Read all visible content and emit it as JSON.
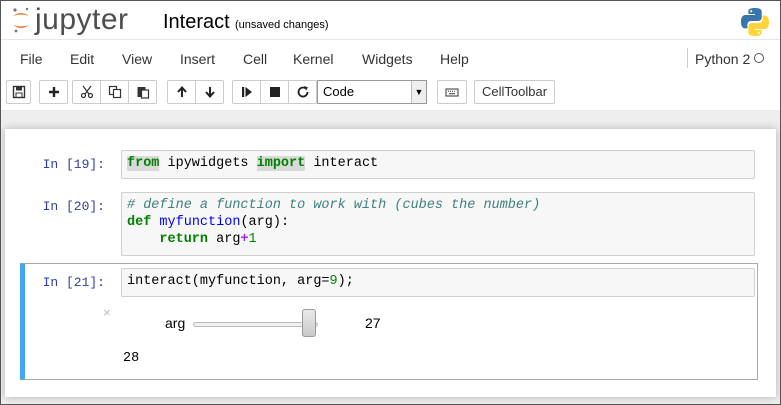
{
  "header": {
    "logo_text": "jupyter",
    "notebook_title": "Interact",
    "save_status": "(unsaved changes)"
  },
  "menubar": {
    "items": [
      "File",
      "Edit",
      "View",
      "Insert",
      "Cell",
      "Kernel",
      "Widgets",
      "Help"
    ],
    "kernel_name": "Python 2"
  },
  "toolbar": {
    "buttons": [
      "save-icon",
      "plus-icon",
      "scissors-icon",
      "copy-icon",
      "paste-icon",
      "arrow-up-icon",
      "arrow-down-icon",
      "step-forward-icon",
      "stop-icon",
      "refresh-icon",
      "keyboard-icon"
    ],
    "cell_type": "Code",
    "celltoolbar_label": "CellToolbar"
  },
  "cells": [
    {
      "prompt": "In [19]:",
      "code": "from ipywidgets import interact"
    },
    {
      "prompt": "In [20]:",
      "code": "# define a function to work with (cubes the number)\ndef myfunction(arg):\n    return arg+1"
    },
    {
      "prompt": "In [21]:",
      "code": "interact(myfunction, arg=9);"
    }
  ],
  "widget": {
    "close_glyph": "×",
    "slider_label": "arg",
    "slider_value": "27",
    "slider_fraction": 0.93
  },
  "output": {
    "text": "28"
  },
  "colors": {
    "selected_cell_border": "#42a5f5",
    "prompt": "#303f9f",
    "jupyter_orange": "#f37726"
  }
}
